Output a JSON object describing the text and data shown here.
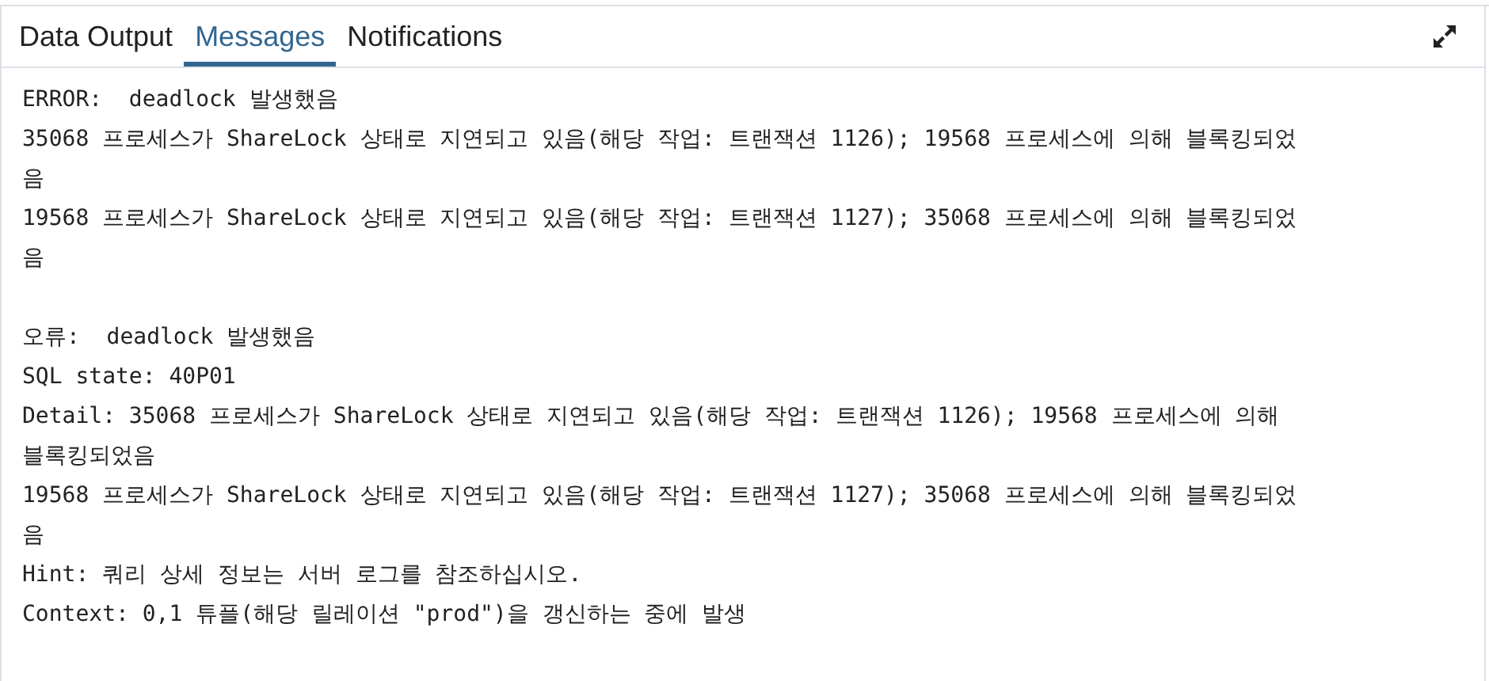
{
  "tabs": [
    {
      "label": "Data Output",
      "selected": false
    },
    {
      "label": "Messages",
      "selected": true
    },
    {
      "label": "Notifications",
      "selected": false
    }
  ],
  "messages": [
    {
      "lines": [
        "ERROR:  deadlock 발생했음",
        "35068 프로세스가 ShareLock 상태로 지연되고 있음(해당 작업: 트랜잭션 1126); 19568 프로세스에 의해 블록킹되었",
        "음",
        "19568 프로세스가 ShareLock 상태로 지연되고 있음(해당 작업: 트랜잭션 1127); 35068 프로세스에 의해 블록킹되었",
        "음"
      ]
    },
    {
      "lines": [
        "오류:  deadlock 발생했음",
        "SQL state: 40P01",
        "Detail: 35068 프로세스가 ShareLock 상태로 지연되고 있음(해당 작업: 트랜잭션 1126); 19568 프로세스에 의해",
        "블록킹되었음",
        "19568 프로세스가 ShareLock 상태로 지연되고 있음(해당 작업: 트랜잭션 1127); 35068 프로세스에 의해 블록킹되었",
        "음",
        "Hint: 쿼리 상세 정보는 서버 로그를 참조하십시오.",
        "Context: 0,1 튜플(해당 릴레이션 \"prod\")을 갱신하는 중에 발생"
      ]
    }
  ]
}
